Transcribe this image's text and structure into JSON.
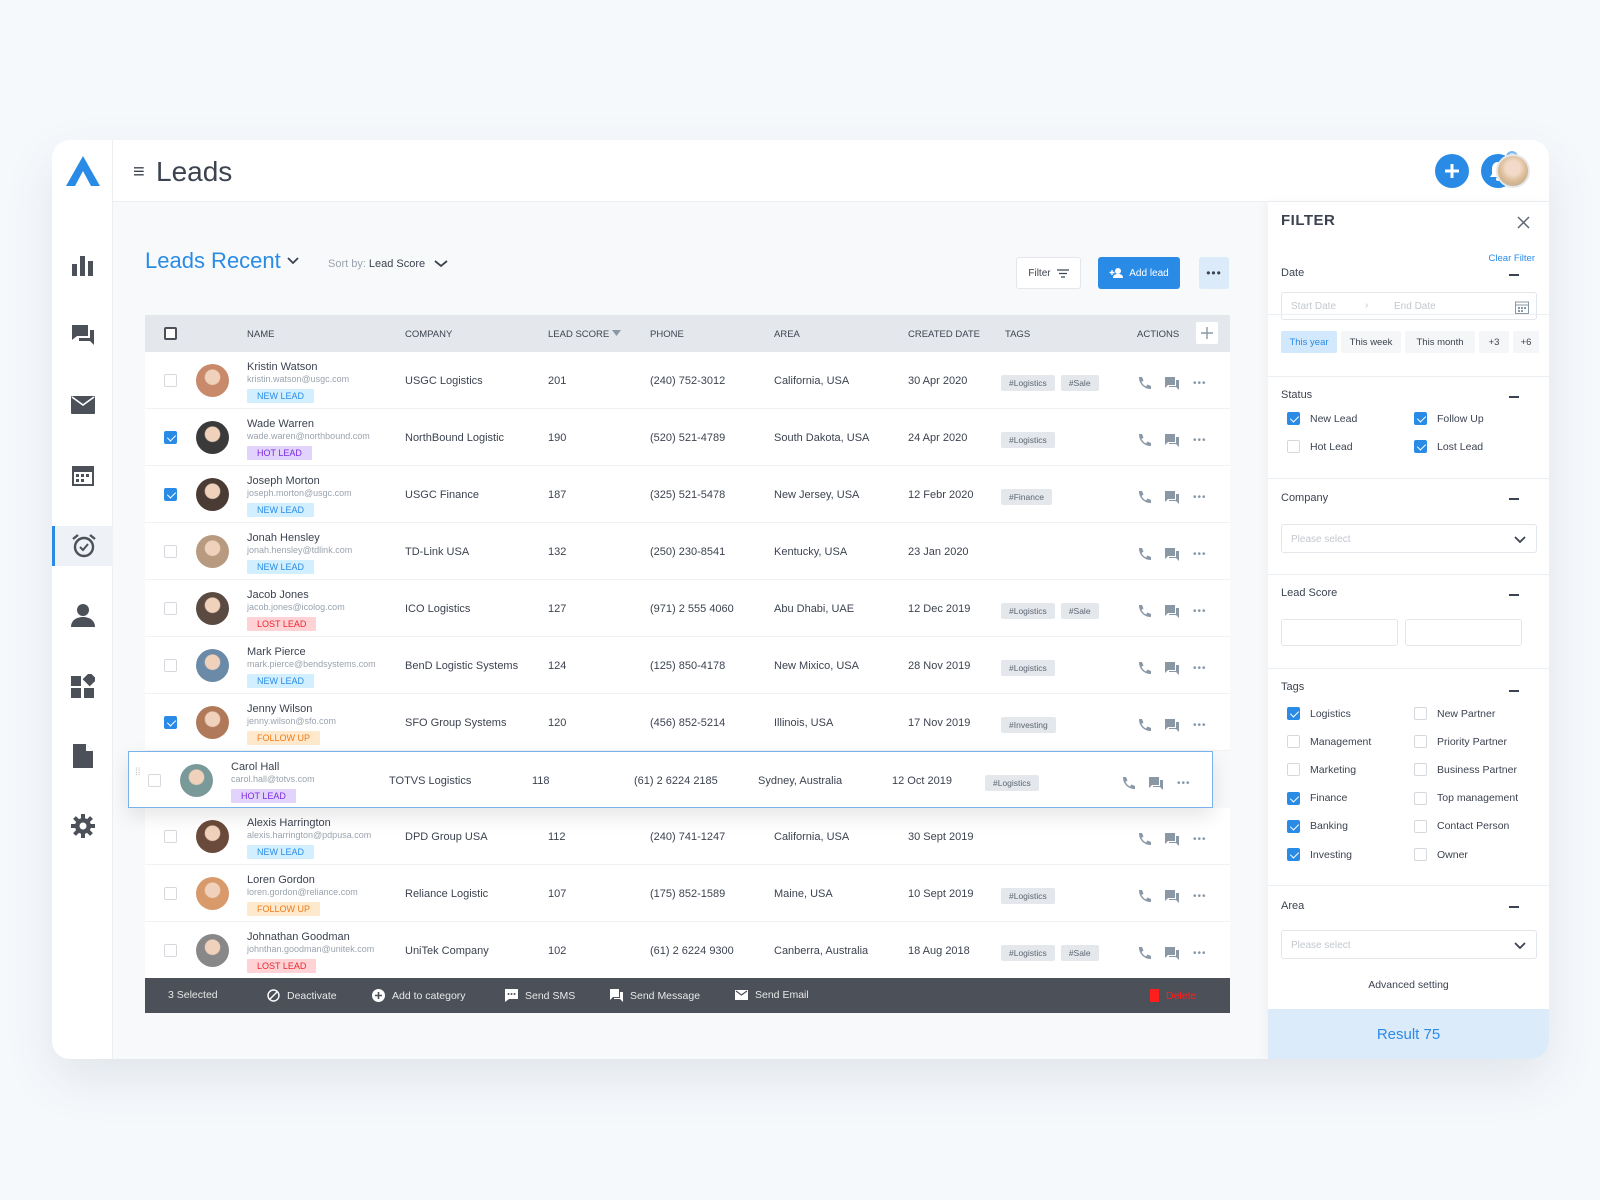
{
  "header": {
    "title": "Leads",
    "notifications": "5"
  },
  "colors": {
    "accent": "#2a8be6",
    "new_lead": "#d2efff",
    "hot_lead": "#e2d3fb",
    "lost_lead": "#ffd3d6",
    "follow_up": "#ffe9cc"
  },
  "toolbar": {
    "view_title": "Leads Recent",
    "sort_label": "Sort by:",
    "sort_value": "Lead Score",
    "filter_label": "Filter",
    "add_label": "Add lead"
  },
  "table": {
    "columns": [
      "NAME",
      "COMPANY",
      "LEAD SCORE",
      "PHONE",
      "AREA",
      "CREATED DATE",
      "TAGS",
      "ACTIONS"
    ],
    "rows": [
      {
        "name": "Kristin Watson",
        "email": "kristin.watson@usgc.com",
        "status": "NEW LEAD",
        "company": "USGC Logistics",
        "score": "201",
        "phone": "(240) 752-3012",
        "area": "California, USA",
        "date": "30 Apr 2020",
        "tags": [
          "#Logistics",
          "#Sale"
        ],
        "checked": false
      },
      {
        "name": "Wade Warren",
        "email": "wade.waren@northbound.com",
        "status": "HOT LEAD",
        "company": "NorthBound Logistic",
        "score": "190",
        "phone": "(520) 521-4789",
        "area": "South Dakota, USA",
        "date": "24 Apr 2020",
        "tags": [
          "#Logistics"
        ],
        "checked": true
      },
      {
        "name": "Joseph Morton",
        "email": "joseph.morton@usgc.com",
        "status": "NEW LEAD",
        "company": "USGC Finance",
        "score": "187",
        "phone": "(325) 521-5478",
        "area": "New Jersey, USA",
        "date": "12 Febr 2020",
        "tags": [
          "#Finance"
        ],
        "checked": true
      },
      {
        "name": "Jonah Hensley",
        "email": "jonah.hensley@tdlink.com",
        "status": "NEW LEAD",
        "company": "TD-Link USA",
        "score": "132",
        "phone": "(250) 230-8541",
        "area": "Kentucky, USA",
        "date": "23 Jan 2020",
        "tags": [],
        "checked": false
      },
      {
        "name": "Jacob Jones",
        "email": "jacob.jones@icolog.com",
        "status": "LOST LEAD",
        "company": "ICO Logistics",
        "score": "127",
        "phone": "(971) 2 555 4060",
        "area": "Abu Dhabi, UAE",
        "date": "12 Dec 2019",
        "tags": [
          "#Logistics",
          "#Sale"
        ],
        "checked": false
      },
      {
        "name": "Mark Pierce",
        "email": "mark.pierce@bendsystems.com",
        "status": "NEW LEAD",
        "company": "BenD Logistic Systems",
        "score": "124",
        "phone": "(125) 850-4178",
        "area": "New Mixico, USA",
        "date": "28 Nov 2019",
        "tags": [
          "#Logistics"
        ],
        "checked": false
      },
      {
        "name": "Jenny Wilson",
        "email": "jenny.wilson@sfo.com",
        "status": "FOLLOW UP",
        "company": "SFO Group Systems",
        "score": "120",
        "phone": "(456) 852-5214",
        "area": "Illinois, USA",
        "date": "17 Nov 2019",
        "tags": [
          "#Investing"
        ],
        "checked": true
      },
      {
        "name": "Carol Hall",
        "email": "carol.hall@totvs.com",
        "status": "HOT LEAD",
        "company": "TOTVS Logistics",
        "score": "118",
        "phone": "(61) 2 6224 2185",
        "area": "Sydney, Australia",
        "date": "12 Oct 2019",
        "tags": [
          "#Logistics"
        ],
        "checked": false,
        "dragging": true
      },
      {
        "name": "Alexis Harrington",
        "email": "alexis.harrington@pdpusa.com",
        "status": "NEW LEAD",
        "company": "DPD Group USA",
        "score": "112",
        "phone": "(240) 741-1247",
        "area": "California, USA",
        "date": "30 Sept 2019",
        "tags": [],
        "checked": false
      },
      {
        "name": "Loren  Gordon",
        "email": "loren.gordon@reliance.com",
        "status": "FOLLOW UP",
        "company": "Reliance Logistic",
        "score": "107",
        "phone": "(175) 852-1589",
        "area": "Maine, USA",
        "date": "10 Sept 2019",
        "tags": [
          "#Logistics"
        ],
        "checked": false
      },
      {
        "name": "Johnathan Goodman",
        "email": "johnthan.goodman@unitek.com",
        "status": "LOST LEAD",
        "company": "UniTek Company",
        "score": "102",
        "phone": "(61) 2 6224 9300",
        "area": "Canberra, Australia",
        "date": "18 Aug 2018",
        "tags": [
          "#Logistics",
          "#Sale"
        ],
        "checked": false
      }
    ]
  },
  "bulk": {
    "selected": "3 Selected",
    "deactivate": "Deactivate",
    "add_category": "Add to category",
    "send_sms": "Send SMS",
    "send_message": "Send Message",
    "send_email": "Send Email",
    "delete": "Delete"
  },
  "filter": {
    "title": "FILTER",
    "clear": "Clear Filter",
    "date": {
      "label": "Date",
      "start_placeholder": "Start Date",
      "end_placeholder": "End Date",
      "chips": [
        "This year",
        "This week",
        "This month",
        "+3",
        "+6"
      ],
      "active_chip": "This year"
    },
    "status": {
      "label": "Status",
      "options": [
        {
          "label": "New Lead",
          "checked": true
        },
        {
          "label": "Follow Up",
          "checked": true
        },
        {
          "label": "Hot Lead",
          "checked": false
        },
        {
          "label": "Lost Lead",
          "checked": true
        }
      ]
    },
    "company": {
      "label": "Company",
      "placeholder": "Please select"
    },
    "lead_score": {
      "label": "Lead Score"
    },
    "tags": {
      "label": "Tags",
      "options": [
        {
          "label": "Logistics",
          "checked": true
        },
        {
          "label": "New Partner",
          "checked": false
        },
        {
          "label": "Management",
          "checked": false
        },
        {
          "label": "Priority Partner",
          "checked": false
        },
        {
          "label": "Marketing",
          "checked": false
        },
        {
          "label": "Business Partner",
          "checked": false
        },
        {
          "label": "Finance",
          "checked": true
        },
        {
          "label": "Top management",
          "checked": false
        },
        {
          "label": "Banking",
          "checked": true
        },
        {
          "label": "Contact Person",
          "checked": false
        },
        {
          "label": "Investing",
          "checked": true
        },
        {
          "label": "Owner",
          "checked": false
        }
      ]
    },
    "area": {
      "label": "Area",
      "placeholder": "Please select"
    },
    "advanced": "Advanced setting",
    "result": "Result 75"
  }
}
